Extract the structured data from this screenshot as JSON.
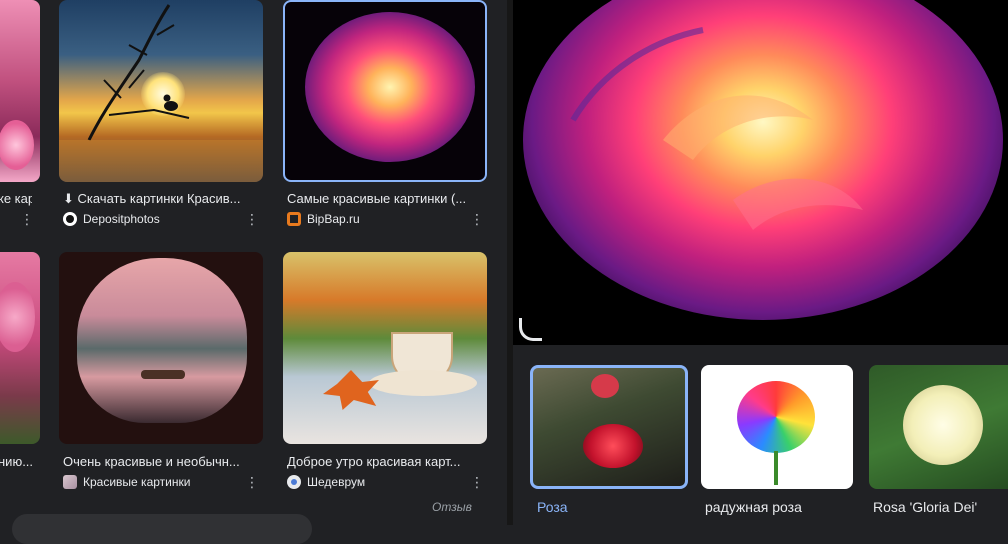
{
  "results": [
    {
      "caption": "ке карт",
      "source": ""
    },
    {
      "caption": "⬇ Скачать картинки Красив...",
      "source": "Depositphotos"
    },
    {
      "caption": "Самые красивые картинки (...",
      "source": "BipBap.ru"
    },
    {
      "caption": "нию...",
      "source": ""
    },
    {
      "caption": "Очень красивые и необычн...",
      "source": "Красивые картинки"
    },
    {
      "caption": "Доброе утро красивая карт...",
      "source": "Шедеврум"
    }
  ],
  "feedback_label": "Отзыв",
  "related": [
    {
      "label": "Роза"
    },
    {
      "label": "радужная роза"
    },
    {
      "label": "Rosa 'Gloria Dei'"
    }
  ],
  "colors": {
    "background": "#202124",
    "selected_border": "#8ab4f8",
    "link_blue": "#8ab4f8"
  }
}
